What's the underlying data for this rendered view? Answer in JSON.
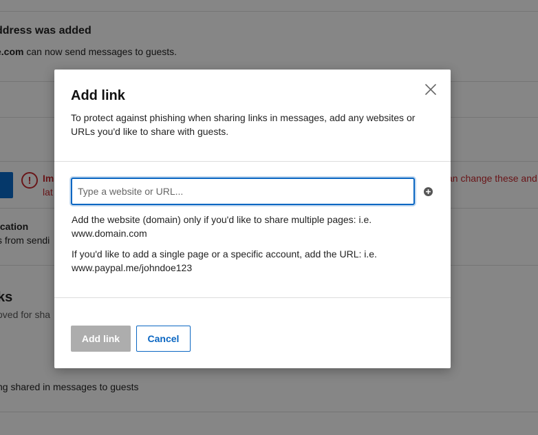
{
  "background": {
    "banner_title": "ddress was added",
    "banner_domain": "e.com",
    "banner_desc": " can now send messages to guests.",
    "alert_lead": "Im",
    "alert_lead2": "lat",
    "alert_tail": "an change these and",
    "verification_title": "ication",
    "verification_desc": "s from sendi",
    "links_title": "ks",
    "links_desc": "oved for sha",
    "shared_text": "ng shared in messages to guests"
  },
  "modal": {
    "title": "Add link",
    "description": "To protect against phishing when sharing links in messages, add any websites or URLs you'd like to share with guests.",
    "input": {
      "placeholder": "Type a website or URL...",
      "value": ""
    },
    "help_domain_line": "Add the website (domain) only if you'd like to share multiple pages: i.e.",
    "help_domain_example": "www.domain.com",
    "help_url_line": "If you'd like to add a single page or a specific account, add the URL: i.e.",
    "help_url_example": "www.paypal.me/johndoe123",
    "add_button": "Add link",
    "cancel_button": "Cancel"
  },
  "icons": {
    "close": "close-icon",
    "add": "plus-circle-icon",
    "alert": "exclamation-circle-icon"
  },
  "colors": {
    "accent": "#0a66c2",
    "alert": "#c0272d",
    "disabled_button": "#adadad"
  }
}
